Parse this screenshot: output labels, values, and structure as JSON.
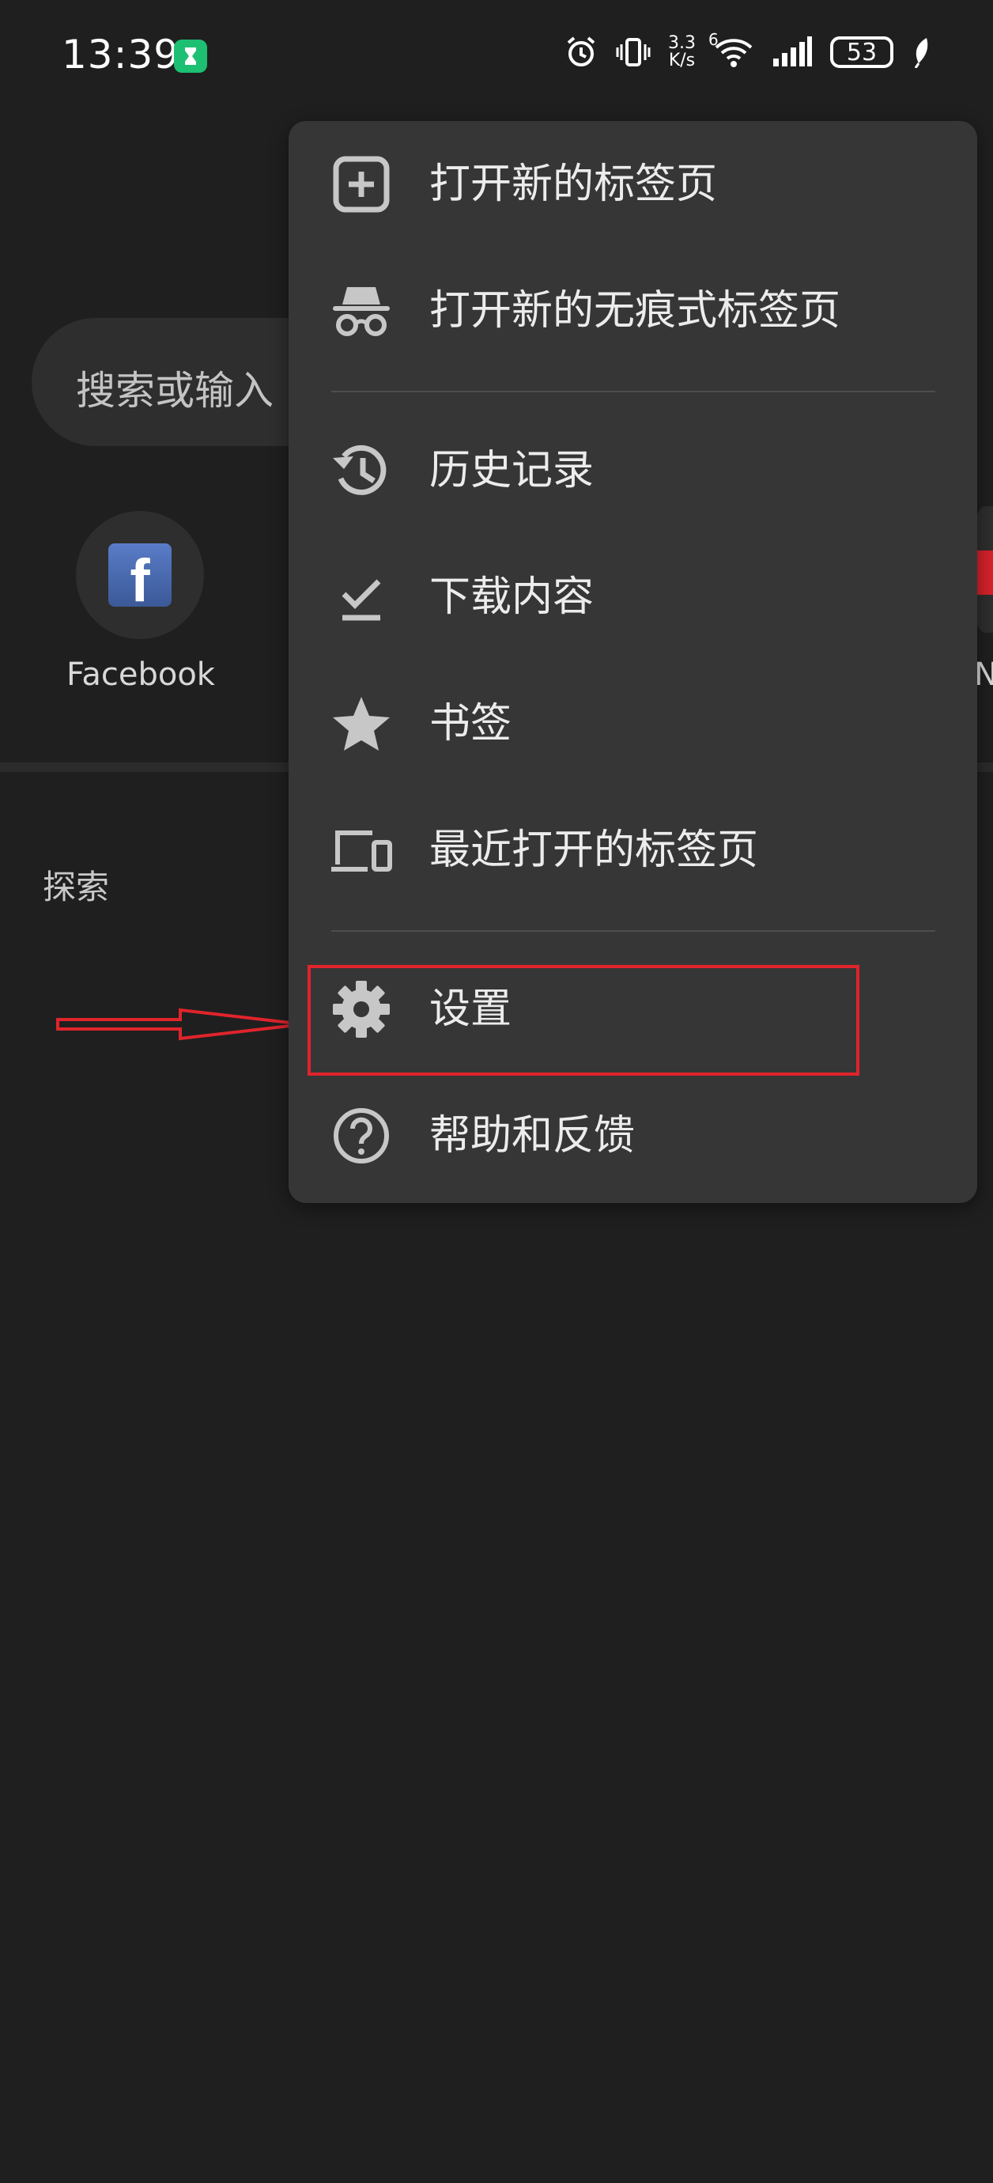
{
  "status_bar": {
    "time": "13:39",
    "net_speed_value": "3.3",
    "net_speed_unit": "K/s",
    "network_type": "6",
    "battery": "53",
    "icons": [
      "hourglass-icon",
      "alarm-icon",
      "vibrate-icon",
      "wifi-icon",
      "signal-icon",
      "battery-icon",
      "leaf-icon"
    ]
  },
  "background": {
    "search_placeholder": "搜索或输入",
    "shortcuts": [
      {
        "label": "Facebook",
        "icon": "facebook-icon"
      },
      {
        "label": "N"
      }
    ],
    "explore_label": "探索"
  },
  "menu": {
    "items": [
      {
        "label": "打开新的标签页",
        "icon": "new-tab-icon"
      },
      {
        "label": "打开新的无痕式标签页",
        "icon": "incognito-icon"
      },
      {
        "label": "历史记录",
        "icon": "history-icon"
      },
      {
        "label": "下载内容",
        "icon": "downloads-icon"
      },
      {
        "label": "书签",
        "icon": "bookmark-star-icon"
      },
      {
        "label": "最近打开的标签页",
        "icon": "recent-tabs-icon"
      },
      {
        "label": "设置",
        "icon": "settings-gear-icon"
      },
      {
        "label": "帮助和反馈",
        "icon": "help-icon"
      }
    ]
  },
  "annotation": {
    "highlight_color": "#e0242c",
    "highlighted_item": "设置"
  },
  "colors": {
    "background": "#1f1f1f",
    "menu_background": "#363636",
    "icon": "#c7c7c7",
    "text": "#ececec"
  }
}
